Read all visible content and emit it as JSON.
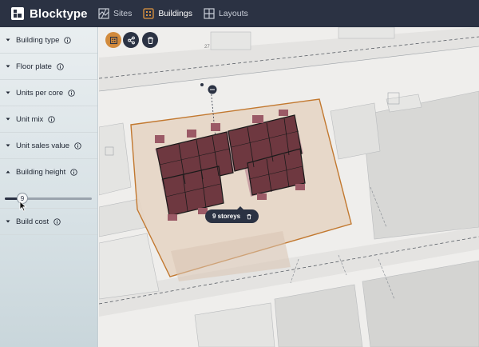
{
  "app": {
    "name": "Blocktype"
  },
  "nav": [
    {
      "label": "Sites",
      "icon": "map-icon",
      "active": false
    },
    {
      "label": "Buildings",
      "icon": "buildings-icon",
      "active": true
    },
    {
      "label": "Layouts",
      "icon": "layouts-icon",
      "active": false
    }
  ],
  "sidebar": {
    "sections": [
      {
        "label": "Building type",
        "expanded": false
      },
      {
        "label": "Floor plate",
        "expanded": false
      },
      {
        "label": "Units per core",
        "expanded": false
      },
      {
        "label": "Unit mix",
        "expanded": false
      },
      {
        "label": "Unit sales value",
        "expanded": false
      },
      {
        "label": "Building height",
        "expanded": true
      },
      {
        "label": "Build cost",
        "expanded": false
      }
    ],
    "height_slider": {
      "value": "9",
      "fraction": 0.2
    }
  },
  "map": {
    "street_label": "27",
    "popup": {
      "label": "9 storeys"
    },
    "tools": [
      {
        "name": "building-tool",
        "icon": "building-icon",
        "color": "#d28a3c"
      },
      {
        "name": "share-tool",
        "icon": "share-icon",
        "color": "#2b3243"
      },
      {
        "name": "delete-tool",
        "icon": "trash-icon",
        "color": "#2b3243"
      }
    ]
  },
  "colors": {
    "topbar": "#2b3243",
    "accent": "#d28a3c",
    "building": "#6e3840",
    "site_fill": "#e6d6c5"
  }
}
